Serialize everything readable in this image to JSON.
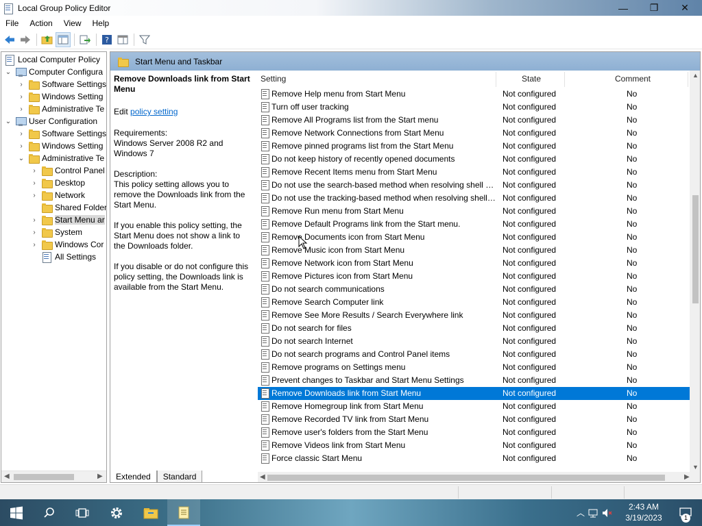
{
  "window": {
    "title": "Local Group Policy Editor",
    "controls": [
      "—",
      "❐",
      "✕"
    ]
  },
  "menu": [
    "File",
    "Action",
    "View",
    "Help"
  ],
  "tree": {
    "root": "Local Computer Policy",
    "items": [
      {
        "label": "Computer Configura",
        "level": 1
      },
      {
        "label": "Software Settings",
        "level": 2
      },
      {
        "label": "Windows Setting",
        "level": 2
      },
      {
        "label": "Administrative Te",
        "level": 2
      },
      {
        "label": "User Configuration",
        "level": 1
      },
      {
        "label": "Software Settings",
        "level": 2
      },
      {
        "label": "Windows Setting",
        "level": 2
      },
      {
        "label": "Administrative Te",
        "level": 2
      },
      {
        "label": "Control Panel",
        "level": 3
      },
      {
        "label": "Desktop",
        "level": 3
      },
      {
        "label": "Network",
        "level": 3
      },
      {
        "label": "Shared Folder",
        "level": 3
      },
      {
        "label": "Start Menu ar",
        "level": 3
      },
      {
        "label": "System",
        "level": 3
      },
      {
        "label": "Windows Cor",
        "level": 3
      },
      {
        "label": "All Settings",
        "level": 3
      }
    ]
  },
  "right_header": {
    "title": "Start Menu and Taskbar"
  },
  "description": {
    "title": "Remove Downloads link from Start Menu",
    "edit_prefix": "Edit",
    "edit_link": "policy setting",
    "requirements_label": "Requirements:",
    "requirements": "Windows Server 2008 R2 and Windows 7",
    "description_label": "Description:",
    "p1": "This policy setting allows you to remove the Downloads link from the Start Menu.",
    "p2": "If you enable this policy setting, the Start Menu does not show a link to the Downloads folder.",
    "p3": "If you disable or do not configure this policy setting, the Downloads link is available from the Start Menu."
  },
  "columns": {
    "setting": "Setting",
    "state": "State",
    "comment": "Comment"
  },
  "rows": [
    {
      "name": "Remove Help menu from Start Menu",
      "state": "Not configured",
      "comment": "No"
    },
    {
      "name": "Turn off user tracking",
      "state": "Not configured",
      "comment": "No"
    },
    {
      "name": "Remove All Programs list from the Start menu",
      "state": "Not configured",
      "comment": "No"
    },
    {
      "name": "Remove Network Connections from Start Menu",
      "state": "Not configured",
      "comment": "No"
    },
    {
      "name": "Remove pinned programs list from the Start Menu",
      "state": "Not configured",
      "comment": "No"
    },
    {
      "name": "Do not keep history of recently opened documents",
      "state": "Not configured",
      "comment": "No"
    },
    {
      "name": "Remove Recent Items menu from Start Menu",
      "state": "Not configured",
      "comment": "No"
    },
    {
      "name": "Do not use the search-based method when resolving shell s...",
      "state": "Not configured",
      "comment": "No"
    },
    {
      "name": "Do not use the tracking-based method when resolving shell ...",
      "state": "Not configured",
      "comment": "No"
    },
    {
      "name": "Remove Run menu from Start Menu",
      "state": "Not configured",
      "comment": "No"
    },
    {
      "name": "Remove Default Programs link from the Start menu.",
      "state": "Not configured",
      "comment": "No"
    },
    {
      "name": "Remove Documents icon from Start Menu",
      "state": "Not configured",
      "comment": "No"
    },
    {
      "name": "Remove Music icon from Start Menu",
      "state": "Not configured",
      "comment": "No"
    },
    {
      "name": "Remove Network icon from Start Menu",
      "state": "Not configured",
      "comment": "No"
    },
    {
      "name": "Remove Pictures icon from Start Menu",
      "state": "Not configured",
      "comment": "No"
    },
    {
      "name": "Do not search communications",
      "state": "Not configured",
      "comment": "No"
    },
    {
      "name": "Remove Search Computer link",
      "state": "Not configured",
      "comment": "No"
    },
    {
      "name": "Remove See More Results / Search Everywhere link",
      "state": "Not configured",
      "comment": "No"
    },
    {
      "name": "Do not search for files",
      "state": "Not configured",
      "comment": "No"
    },
    {
      "name": "Do not search Internet",
      "state": "Not configured",
      "comment": "No"
    },
    {
      "name": "Do not search programs and Control Panel items",
      "state": "Not configured",
      "comment": "No"
    },
    {
      "name": "Remove programs on Settings menu",
      "state": "Not configured",
      "comment": "No"
    },
    {
      "name": "Prevent changes to Taskbar and Start Menu Settings",
      "state": "Not configured",
      "comment": "No"
    },
    {
      "name": "Remove Downloads link from Start Menu",
      "state": "Not configured",
      "comment": "No",
      "selected": true
    },
    {
      "name": "Remove Homegroup link from Start Menu",
      "state": "Not configured",
      "comment": "No"
    },
    {
      "name": "Remove Recorded TV link from Start Menu",
      "state": "Not configured",
      "comment": "No"
    },
    {
      "name": "Remove user's folders from the Start Menu",
      "state": "Not configured",
      "comment": "No"
    },
    {
      "name": "Remove Videos link from Start Menu",
      "state": "Not configured",
      "comment": "No"
    },
    {
      "name": "Force classic Start Menu",
      "state": "Not configured",
      "comment": "No"
    }
  ],
  "tabs": [
    "Extended",
    "Standard"
  ],
  "taskbar": {
    "time": "2:43 AM",
    "date": "3/19/2023",
    "notification_count": "1"
  },
  "colors": {
    "selection": "#0078d7",
    "header": "#9ab8d8",
    "link": "#0066cc"
  }
}
